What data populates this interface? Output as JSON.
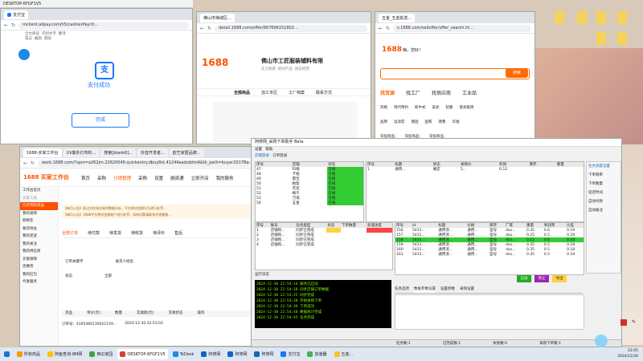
{
  "desktop": {
    "icons": [
      "",
      "",
      "",
      "",
      "",
      ""
    ]
  },
  "win_alipay": {
    "title": "DESKTOP-6FGF1V5",
    "tab": "支付宝",
    "url": "mclient.alipay.com/h5/cashierPay.ht...",
    "pay_success": "支付成功",
    "done_label": "完成",
    "top_tools": [
      "全文阅读",
      "识别文字",
      "翻译",
      "笔记",
      "截图",
      "帮助"
    ]
  },
  "win_shop1": {
    "tab": "佛山市禅城区...",
    "url": "detail.1688.com/offer/667696151802...",
    "logo": "1688",
    "company": "佛山市工匠服装辅料有限",
    "nav": [
      "全部商品",
      "加工专区",
      "工厂档案",
      "联系方式"
    ],
    "meta": [
      "实力商家",
      "原创产品",
      "诚信经营"
    ]
  },
  "win_shop2": {
    "tab": "五金_五金批发...",
    "url": "s.1688.com/selloffer/offer_search.ht...",
    "logo": "1688",
    "greet": "嗨，您好！",
    "search_btn": "搜索",
    "cats": [
      "找货源",
      "找工厂",
      "找供应商",
      "工业品"
    ],
    "tags_row1": [
      "风格",
      "现代简约",
      "新中式",
      "美式",
      "轻奢",
      "意式极简",
      "法式复古",
      "北欧"
    ],
    "tags_row2": [
      "品牌",
      "远洋宏",
      "德固",
      "固和",
      "德鲁",
      "华福",
      "金界达",
      "名宇"
    ],
    "tags_row3": [
      "深层商品：",
      "深层商品：",
      "深层商品："
    ]
  },
  "win_1688": {
    "tabs": [
      "1688-买家工作台",
      "UV紫外灯布料...",
      "搜索[blank6]...",
      "抖音开发者...",
      "欧艺家居品牌..."
    ],
    "url": "work.1688.com/?spm=a262jm.22620049.quickentry.dbuy8st.41244aadzddmA&tk_path=buyer2017Base...",
    "logo": "1688 买家工作台",
    "nav": [
      "首页",
      "采购",
      "分销管理",
      "采购",
      "设置",
      "融资通",
      "立即开店",
      "我的服务"
    ],
    "sidebar": [
      "工作台首页",
      "买家工具",
      "已买到的货品",
      "我的采购",
      "购物车",
      "收货地址",
      "我的足迹",
      "我的关注",
      "我的供应商",
      "买家保障",
      "优惠券",
      "我的红包",
      "代发服务"
    ],
    "notice1": "【每月公告】经过对在线交易的数据分析，平台将对违规行为进行处罚...",
    "notice2": "【每月公告】1688平台将对违规商户进行处罚，如有问题请联系在线客服...",
    "order_tabs": [
      "全部订单",
      "待付款",
      "待发货",
      "待收货",
      "待评价",
      "售后"
    ],
    "filters": [
      "订单关键字",
      "收货人姓名",
      "状态"
    ],
    "all_label": "全部",
    "table_headers": [
      "货品",
      "单价(元)",
      "数量",
      "实收款(元)",
      "交易状态",
      "操作"
    ],
    "order_id": "订单号：4165460130021159...",
    "order_date": "2024-12-30 22:53:03",
    "export_btn": "导出"
  },
  "app": {
    "title": "阿修网_采购下单助手 Beta",
    "menu": [
      "设置",
      "帮助"
    ],
    "tabs": [
      "店铺登录",
      "订单登录"
    ],
    "left_headers": [
      "序号",
      "店铺",
      "状态"
    ],
    "left_rows": [
      [
        "47",
        "科德",
        "在线"
      ],
      [
        "48",
        "卡帕",
        "在线"
      ],
      [
        "49",
        "雷宝",
        "在线"
      ],
      [
        "50",
        "柏梨",
        "在线"
      ],
      [
        "51",
        "杰克",
        "在线"
      ],
      [
        "52",
        "梅干",
        "在线"
      ],
      [
        "53",
        "万瑞",
        "在线"
      ],
      [
        "54",
        "五金",
        "在线"
      ]
    ],
    "right_headers": [
      "序号",
      "标题",
      "状态",
      "采购价",
      "利润",
      "库存",
      "重量"
    ],
    "right_rows": [
      [
        "1",
        "通用...",
        "确定",
        "5...",
        "0.12",
        "",
        ""
      ]
    ],
    "task_headers": [
      "序号",
      "账号",
      "任务类型",
      "状态",
      "下单数量",
      "处理进度"
    ],
    "task_rows": [
      [
        "1",
        "店铺购...",
        "同步已完成",
        "",
        "",
        ""
      ],
      [
        "2",
        "店铺购...",
        "同步已完成",
        "",
        "",
        ""
      ],
      [
        "3",
        "店铺购...",
        "同步已完成",
        "",
        "",
        ""
      ],
      [
        "4",
        "店铺购...",
        "同步已完成",
        "",
        "",
        ""
      ]
    ],
    "grid_headers": [
      "序号",
      "id",
      "标题",
      "价格",
      "库存",
      "厂家",
      "重量",
      "利润率",
      "价差"
    ],
    "grid_rows": [
      [
        "156",
        "5431...",
        "通用消...",
        "通用...",
        "型号",
        "dsa...",
        "0.35",
        "0.6",
        "0.19"
      ],
      [
        "157",
        "5431...",
        "通用消...",
        "通用...",
        "型号",
        "dsa...",
        "0.25",
        "0.5",
        "0.29"
      ],
      [
        "158",
        "5431...",
        "通用消...",
        "通用...",
        "型号",
        "dsa...",
        "0.15",
        "0.6",
        "0.18"
      ],
      [
        "159",
        "5431...",
        "通用消...",
        "通用...",
        "型号",
        "dsa...",
        "0.35",
        "0.5",
        "0.18"
      ],
      [
        "160",
        "5431...",
        "通用消...",
        "通用...",
        "型号",
        "dsa...",
        "0.35",
        "0.5",
        "0.18"
      ],
      [
        "161",
        "5431...",
        "通用消...",
        "通用...",
        "型号",
        "dsa...",
        "0.35",
        "0.5",
        "0.18"
      ]
    ],
    "log_title": "运行日志",
    "log_lines": [
      "2024-12-30 22:54:14 服务已启动",
      "2024-12-30 22:54:18 同步店铺订单数据",
      "2024-12-30 22:54:25 同步完成",
      "2024-12-30 22:54:30 开始采购下单",
      "2024-12-30 22:54:36 下单成功",
      "2024-12-30 22:54:40 数据统计完成",
      "2024-12-30 22:54:45 任务完成"
    ],
    "bottom_tabs": [
      "任务选项",
      "数据参数设置",
      "设置参数",
      "采购设置"
    ],
    "right_panel_title": "任务调度设置",
    "right_panel_items": [
      "下单频率",
      "下单数量",
      "延迟时间",
      "自动付款",
      "自动备注"
    ],
    "status_bar": [
      "任务数:1",
      "已完成数:1",
      "失败数:0",
      "采购下单数:1"
    ],
    "buttons": [
      "启动",
      "停止",
      "导出"
    ]
  },
  "taskbar": {
    "items": [
      "所有商品",
      "阿鱼查询-8M网",
      "西瓜家园",
      "DESKTOP-6FGF1V5",
      "ToDesk",
      "阿修网",
      "阿修网",
      "阿修网",
      "支付宝",
      "加速器",
      "五金..."
    ],
    "time": "22:05",
    "date": "2024/12/30"
  }
}
